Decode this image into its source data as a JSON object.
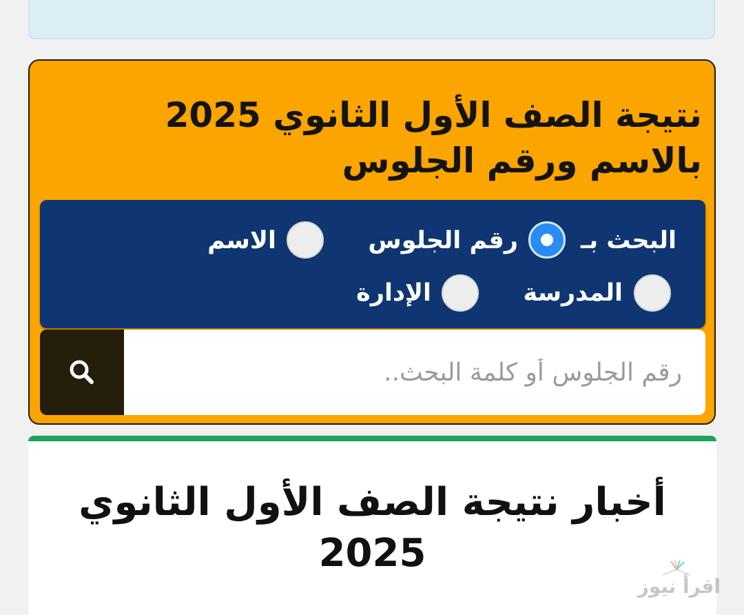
{
  "orange_card": {
    "title_line1": "نتيجة الصف الأول الثانوي 2025",
    "title_line2": "بالاسم ورقم الجلوس"
  },
  "search_options": {
    "label": "البحث بـ",
    "seat_number": "رقم الجلوس",
    "name": "الاسم",
    "school": "المدرسة",
    "administration": "الإدارة",
    "selected": "seat_number"
  },
  "search": {
    "placeholder": "رقم الجلوس أو كلمة البحث.."
  },
  "news": {
    "title_line1": "أخبار نتيجة الصف الأول الثانوي",
    "title_line2": "2025"
  },
  "watermark": {
    "text": "اقرأ نيوز"
  },
  "colors": {
    "card_orange": "#fca500",
    "panel_blue": "#0f3672",
    "radio_selected": "#2a8cf0",
    "search_button": "#241e0a",
    "news_accent": "#1ea35a"
  }
}
